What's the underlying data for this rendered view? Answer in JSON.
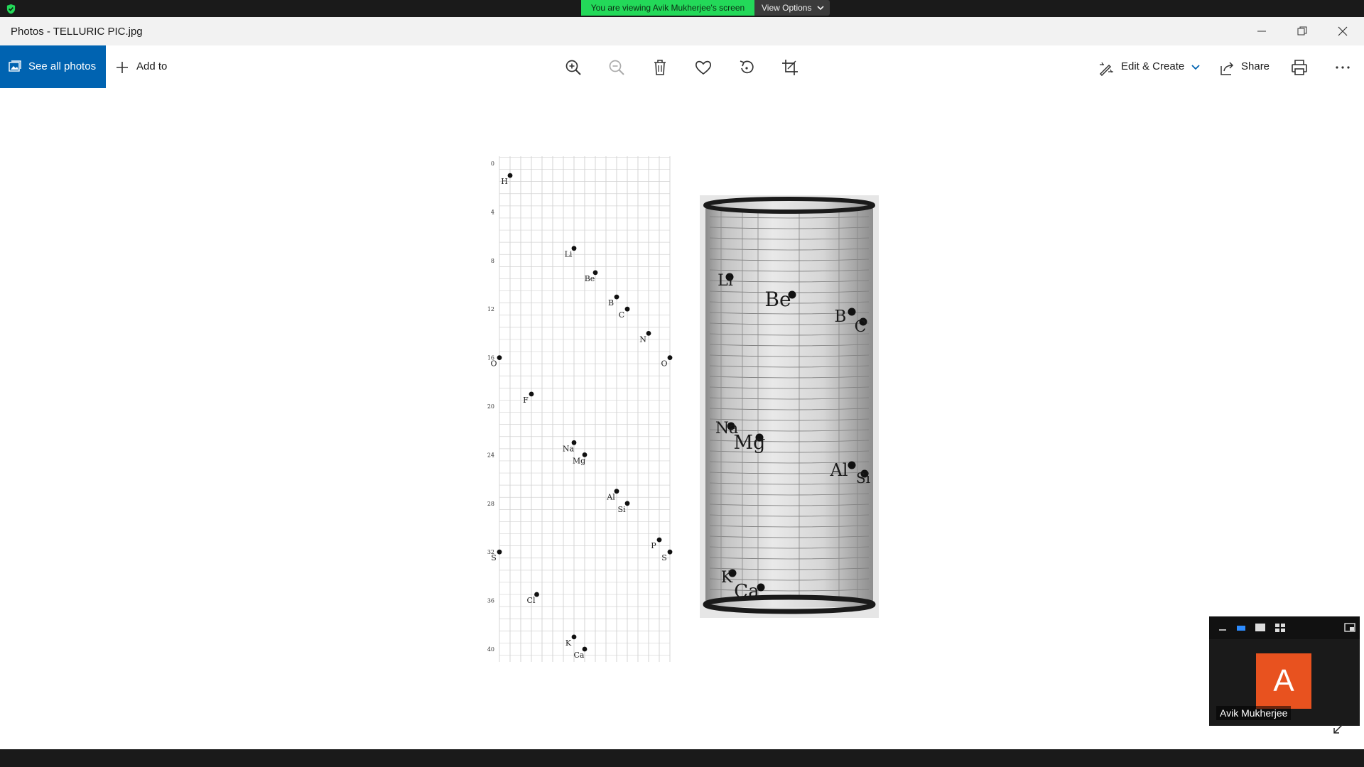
{
  "share_bar": {
    "banner": "You are viewing Avik Mukherjee's screen",
    "view_options": "View Options"
  },
  "window": {
    "title": "Photos - TELLURIC PIC.jpg"
  },
  "toolbar": {
    "see_all_photos": "See all photos",
    "add_to": "Add to",
    "edit_create": "Edit & Create",
    "share": "Share",
    "icons": [
      "zoom-in-icon",
      "zoom-out-icon",
      "delete-icon",
      "heart-icon",
      "rotate-icon",
      "crop-icon",
      "print-icon",
      "more-icon"
    ]
  },
  "photo": {
    "grid_axis_ticks": [
      "0",
      "4",
      "8",
      "12",
      "16",
      "20",
      "24",
      "28",
      "32",
      "36",
      "40"
    ],
    "grid_elements": [
      {
        "label": "H",
        "mass": 1.0
      },
      {
        "label": "Li",
        "mass": 7.0
      },
      {
        "label": "Be",
        "mass": 9.0
      },
      {
        "label": "B",
        "mass": 11.0
      },
      {
        "label": "C",
        "mass": 12.0
      },
      {
        "label": "N",
        "mass": 14.0
      },
      {
        "label": "O",
        "mass": 16.0
      },
      {
        "label": "O",
        "mass": 16.0
      },
      {
        "label": "F",
        "mass": 19.0
      },
      {
        "label": "Na",
        "mass": 23.0
      },
      {
        "label": "Mg",
        "mass": 24.0
      },
      {
        "label": "Al",
        "mass": 27.0
      },
      {
        "label": "Si",
        "mass": 28.0
      },
      {
        "label": "P",
        "mass": 31.0
      },
      {
        "label": "S",
        "mass": 32.0
      },
      {
        "label": "S",
        "mass": 32.0
      },
      {
        "label": "Cl",
        "mass": 35.5
      },
      {
        "label": "K",
        "mass": 39.0
      },
      {
        "label": "Ca",
        "mass": 40.0
      }
    ],
    "cylinder_labels": [
      "Li",
      "Be",
      "B",
      "C",
      "Na",
      "Mg",
      "Al",
      "Si",
      "K",
      "Ca"
    ]
  },
  "participant": {
    "initial": "A",
    "name": "Avik Mukherjee",
    "avatar_color": "#e8521f"
  },
  "colors": {
    "accent": "#0063b1",
    "share_banner": "#23d959"
  }
}
